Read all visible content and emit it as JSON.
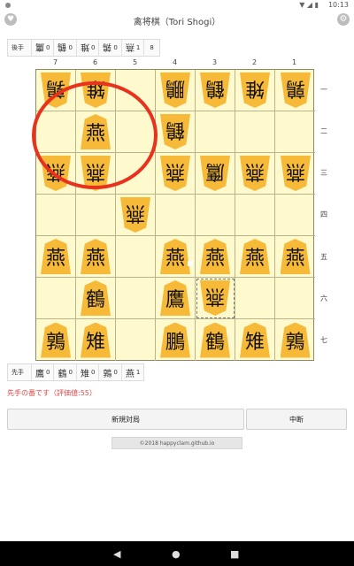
{
  "statusbar": {
    "time": "10:13",
    "icons": "▼ ◢ ▮"
  },
  "app": {
    "title": "禽将棋（Tori Shogi）",
    "heart_icon": "♥",
    "gear_icon": "⚙"
  },
  "gote_hand": {
    "label": "後手",
    "items": [
      {
        "kanji": "鷹",
        "count": "0"
      },
      {
        "kanji": "鶴",
        "count": "0"
      },
      {
        "kanji": "雉",
        "count": "0"
      },
      {
        "kanji": "鶉",
        "count": "0"
      },
      {
        "kanji": "燕",
        "count": "1"
      }
    ],
    "total": "8"
  },
  "sente_hand": {
    "label": "先手",
    "items": [
      {
        "kanji": "鷹",
        "count": "0"
      },
      {
        "kanji": "鶴",
        "count": "0"
      },
      {
        "kanji": "雉",
        "count": "0"
      },
      {
        "kanji": "鶉",
        "count": "0"
      },
      {
        "kanji": "燕",
        "count": "1"
      }
    ]
  },
  "board": {
    "columns": [
      "7",
      "6",
      "5",
      "4",
      "3",
      "2",
      "1"
    ],
    "rows": [
      "一",
      "二",
      "三",
      "四",
      "五",
      "六",
      "七"
    ],
    "cells": [
      [
        {
          "k": "鶉",
          "o": "g"
        },
        {
          "k": "雉",
          "o": "g"
        },
        null,
        {
          "k": "鵬",
          "o": "g"
        },
        {
          "k": "鶴",
          "o": "g"
        },
        {
          "k": "雉",
          "o": "g"
        },
        {
          "k": "鶉",
          "o": "g"
        }
      ],
      [
        null,
        {
          "k": "燕",
          "o": "s"
        },
        null,
        {
          "k": "鶴",
          "o": "g"
        },
        null,
        null,
        null
      ],
      [
        {
          "k": "燕",
          "o": "g"
        },
        {
          "k": "燕",
          "o": "g"
        },
        null,
        {
          "k": "燕",
          "o": "g"
        },
        {
          "k": "鷹",
          "o": "g"
        },
        {
          "k": "燕",
          "o": "g"
        },
        {
          "k": "燕",
          "o": "g"
        }
      ],
      [
        null,
        null,
        {
          "k": "燕",
          "o": "g"
        },
        null,
        null,
        null,
        null
      ],
      [
        {
          "k": "燕",
          "o": "s"
        },
        {
          "k": "燕",
          "o": "s"
        },
        null,
        {
          "k": "燕",
          "o": "s"
        },
        {
          "k": "燕",
          "o": "s"
        },
        {
          "k": "燕",
          "o": "s"
        },
        {
          "k": "燕",
          "o": "s"
        }
      ],
      [
        null,
        {
          "k": "鶴",
          "o": "s"
        },
        null,
        {
          "k": "鷹",
          "o": "s"
        },
        {
          "k": "燕",
          "o": "g"
        },
        null,
        null
      ],
      [
        {
          "k": "鶉",
          "o": "s"
        },
        {
          "k": "雉",
          "o": "s"
        },
        null,
        {
          "k": "鵬",
          "o": "s"
        },
        {
          "k": "鶴",
          "o": "s"
        },
        {
          "k": "雉",
          "o": "s"
        },
        {
          "k": "鶉",
          "o": "s"
        }
      ]
    ]
  },
  "status_message": "先手の番です（評価値:55）",
  "buttons": {
    "new_game": "新規対局",
    "pause": "中断"
  },
  "footer": "©2018 happyclam.github.io",
  "navbar": {
    "back": "◀",
    "home": "●",
    "recent": "■"
  },
  "colors": {
    "board": "#fffacd",
    "piece": "#f6b938",
    "annotation": "#e8321e"
  }
}
